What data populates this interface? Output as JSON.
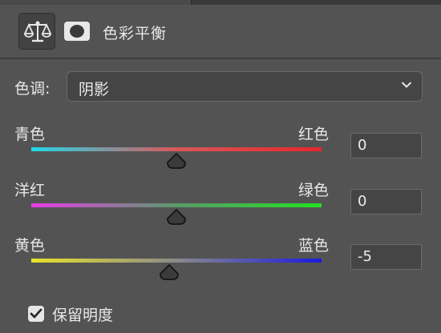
{
  "header": {
    "title": "色彩平衡",
    "adjustment_icon": "balance-scale-icon",
    "mask_icon": "layer-mask-icon"
  },
  "tone": {
    "label": "色调:",
    "value": "阴影"
  },
  "sliders": [
    {
      "left_label": "青色",
      "right_label": "红色",
      "value": "0",
      "level": 0,
      "gradient": [
        "#22d8e8",
        "#d8585a",
        "#e8262a"
      ]
    },
    {
      "left_label": "洋红",
      "right_label": "绿色",
      "value": "0",
      "level": 0,
      "gradient": [
        "#e83ce8",
        "#5a9a6a",
        "#22e022"
      ]
    },
    {
      "left_label": "黄色",
      "right_label": "蓝色",
      "value": "-5",
      "level": -5,
      "gradient": [
        "#e8e22a",
        "#8a8a8a",
        "#1a1ae0"
      ]
    }
  ],
  "preserve_luminosity": {
    "label": "保留明度",
    "checked": true
  },
  "colors": {
    "panel_bg": "#535353",
    "input_bg": "#454545"
  }
}
